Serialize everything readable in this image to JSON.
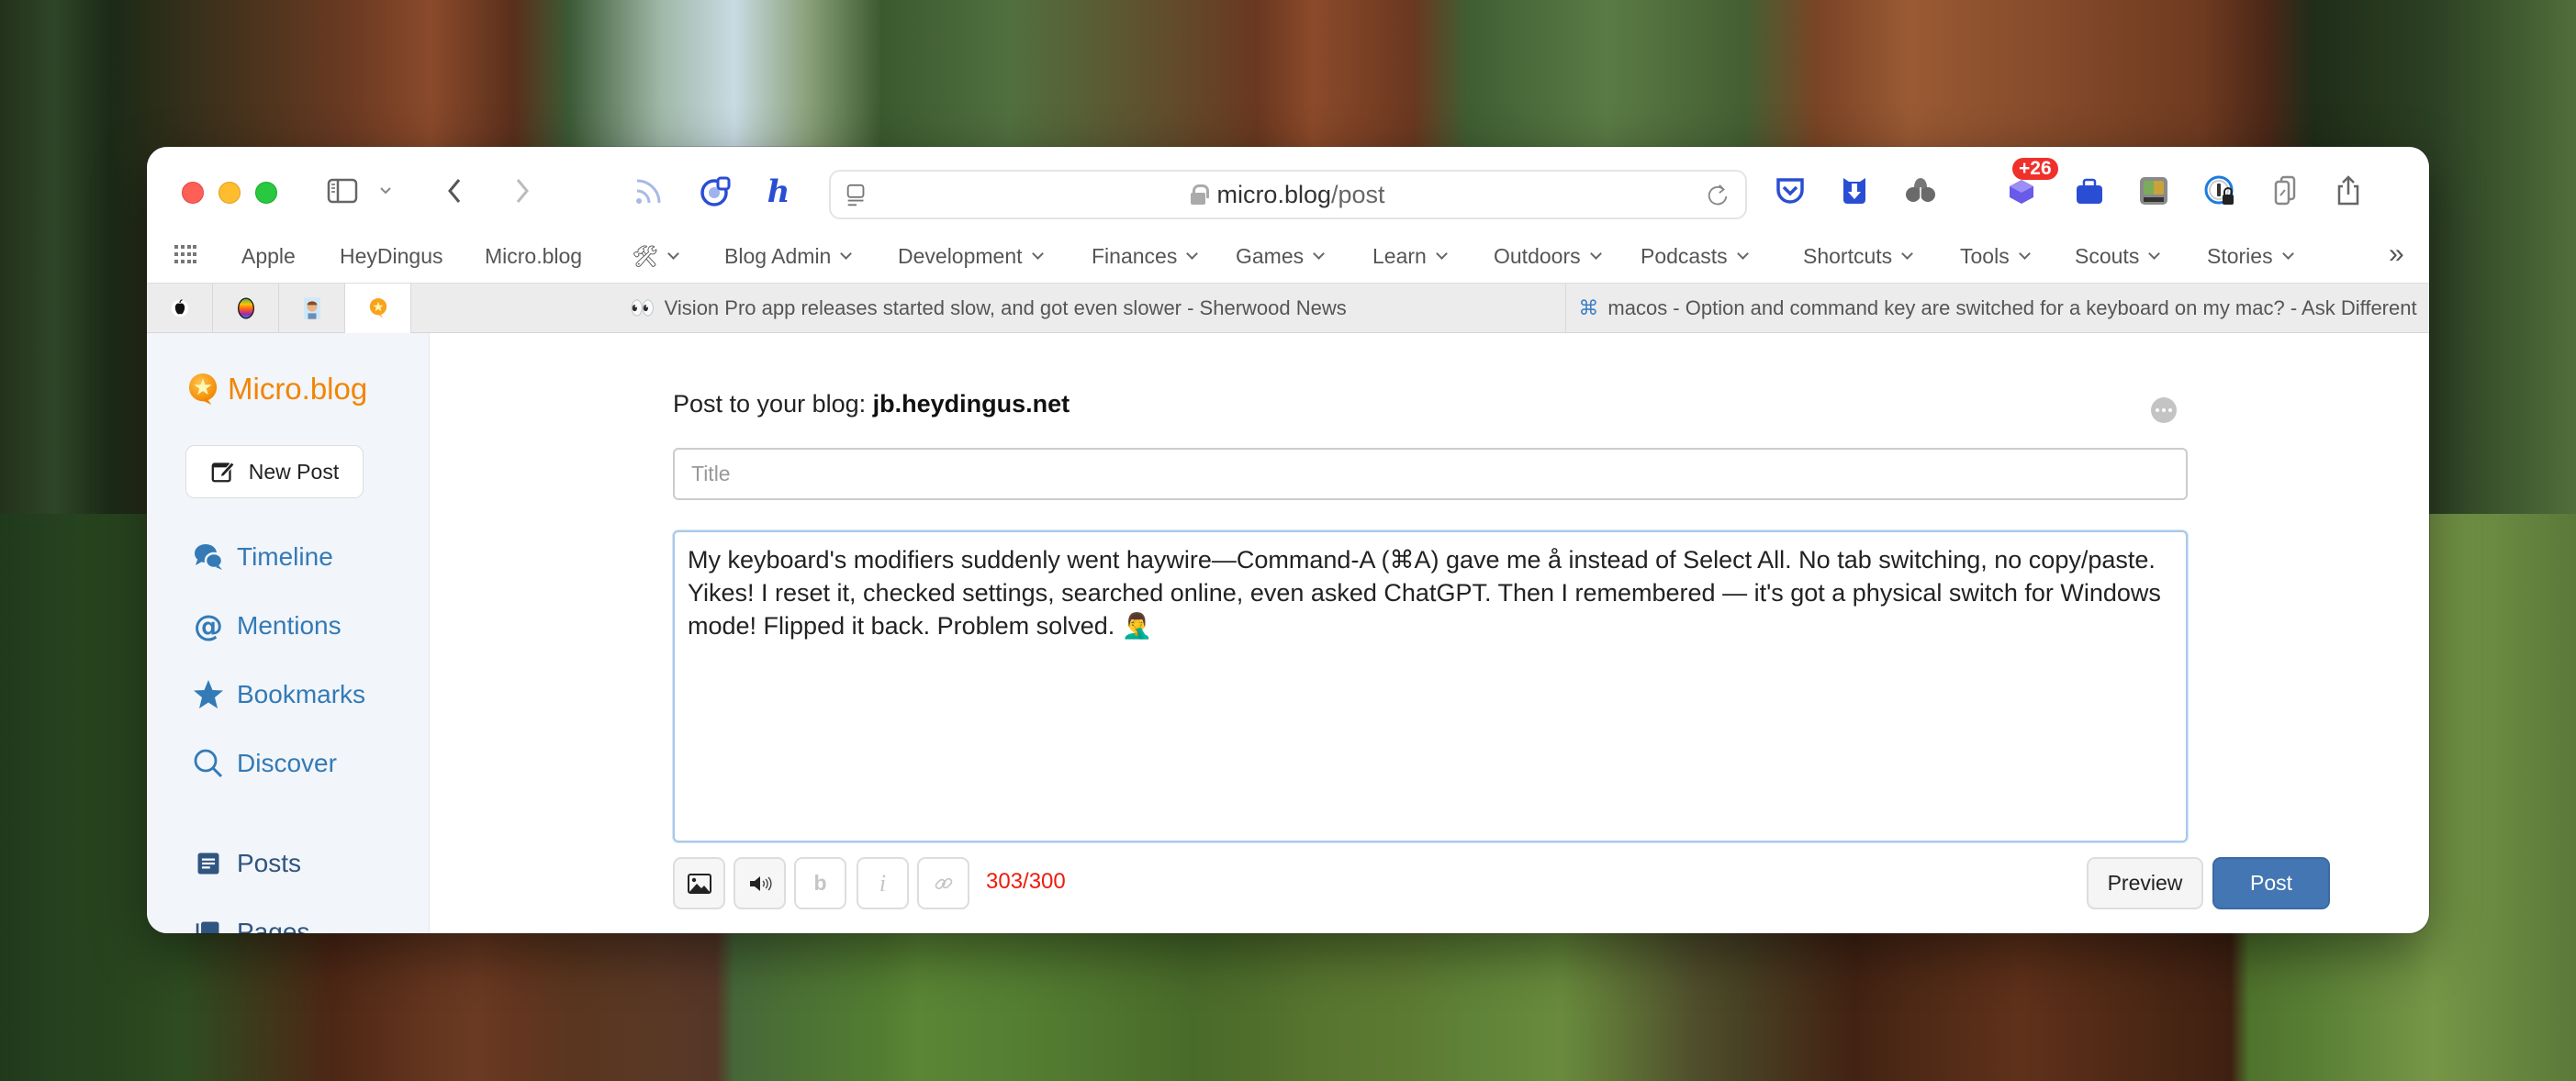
{
  "browser": {
    "url_domain": "micro.blog",
    "url_path": "/post",
    "extension_badge": "+26",
    "bookmarks": [
      {
        "label": "Apple",
        "dropdown": false
      },
      {
        "label": "HeyDingus",
        "dropdown": false
      },
      {
        "label": "Micro.blog",
        "dropdown": false
      },
      {
        "label": "🛠",
        "dropdown": true
      },
      {
        "label": "Blog Admin",
        "dropdown": true
      },
      {
        "label": "Development",
        "dropdown": true
      },
      {
        "label": "Finances",
        "dropdown": true
      },
      {
        "label": "Games",
        "dropdown": true
      },
      {
        "label": "Learn",
        "dropdown": true
      },
      {
        "label": "Outdoors",
        "dropdown": true
      },
      {
        "label": "Podcasts",
        "dropdown": true
      },
      {
        "label": "Shortcuts",
        "dropdown": true
      },
      {
        "label": "Tools",
        "dropdown": true
      },
      {
        "label": "Scouts",
        "dropdown": true
      },
      {
        "label": "Stories",
        "dropdown": true
      }
    ],
    "overflow_label": "»",
    "tabs": [
      {
        "icon": "👀",
        "title": "Vision Pro app releases started slow, and got even slower - Sherwood News"
      },
      {
        "icon": "⌘",
        "title": "macos - Option and command key are switched for a keyboard on my mac? - Ask Different"
      }
    ]
  },
  "sidebar": {
    "brand": "Micro.blog",
    "new_post_label": "New Post",
    "items": [
      {
        "label": "Timeline",
        "icon": "chat-bubbles-icon"
      },
      {
        "label": "Mentions",
        "icon": "at-icon"
      },
      {
        "label": "Bookmarks",
        "icon": "star-icon"
      },
      {
        "label": "Discover",
        "icon": "search-icon"
      },
      {
        "label": "Posts",
        "icon": "posts-icon"
      },
      {
        "label": "Pages",
        "icon": "pages-icon"
      }
    ]
  },
  "composer": {
    "heading_prefix": "Post to your blog: ",
    "blog_name": "jb.heydingus.net",
    "title_placeholder": "Title",
    "title_value": "",
    "body": "My keyboard's modifiers suddenly went haywire—Command-A (⌘A) gave me å instead of Select All. No tab switching, no copy/paste. Yikes! I reset it, checked settings, searched online, even asked ChatGPT. Then I remembered — it's got a physical switch for Windows mode! Flipped it back. Problem solved. 🤦‍♂️",
    "bold_label": "b",
    "italic_label": "i",
    "char_count": "303/300",
    "preview_label": "Preview",
    "post_label": "Post"
  },
  "colors": {
    "brand_orange": "#f28500",
    "link_blue": "#337ab7",
    "post_button": "#4376b2",
    "over_limit_red": "#ee1c0c",
    "badge_red": "#f0302a"
  }
}
